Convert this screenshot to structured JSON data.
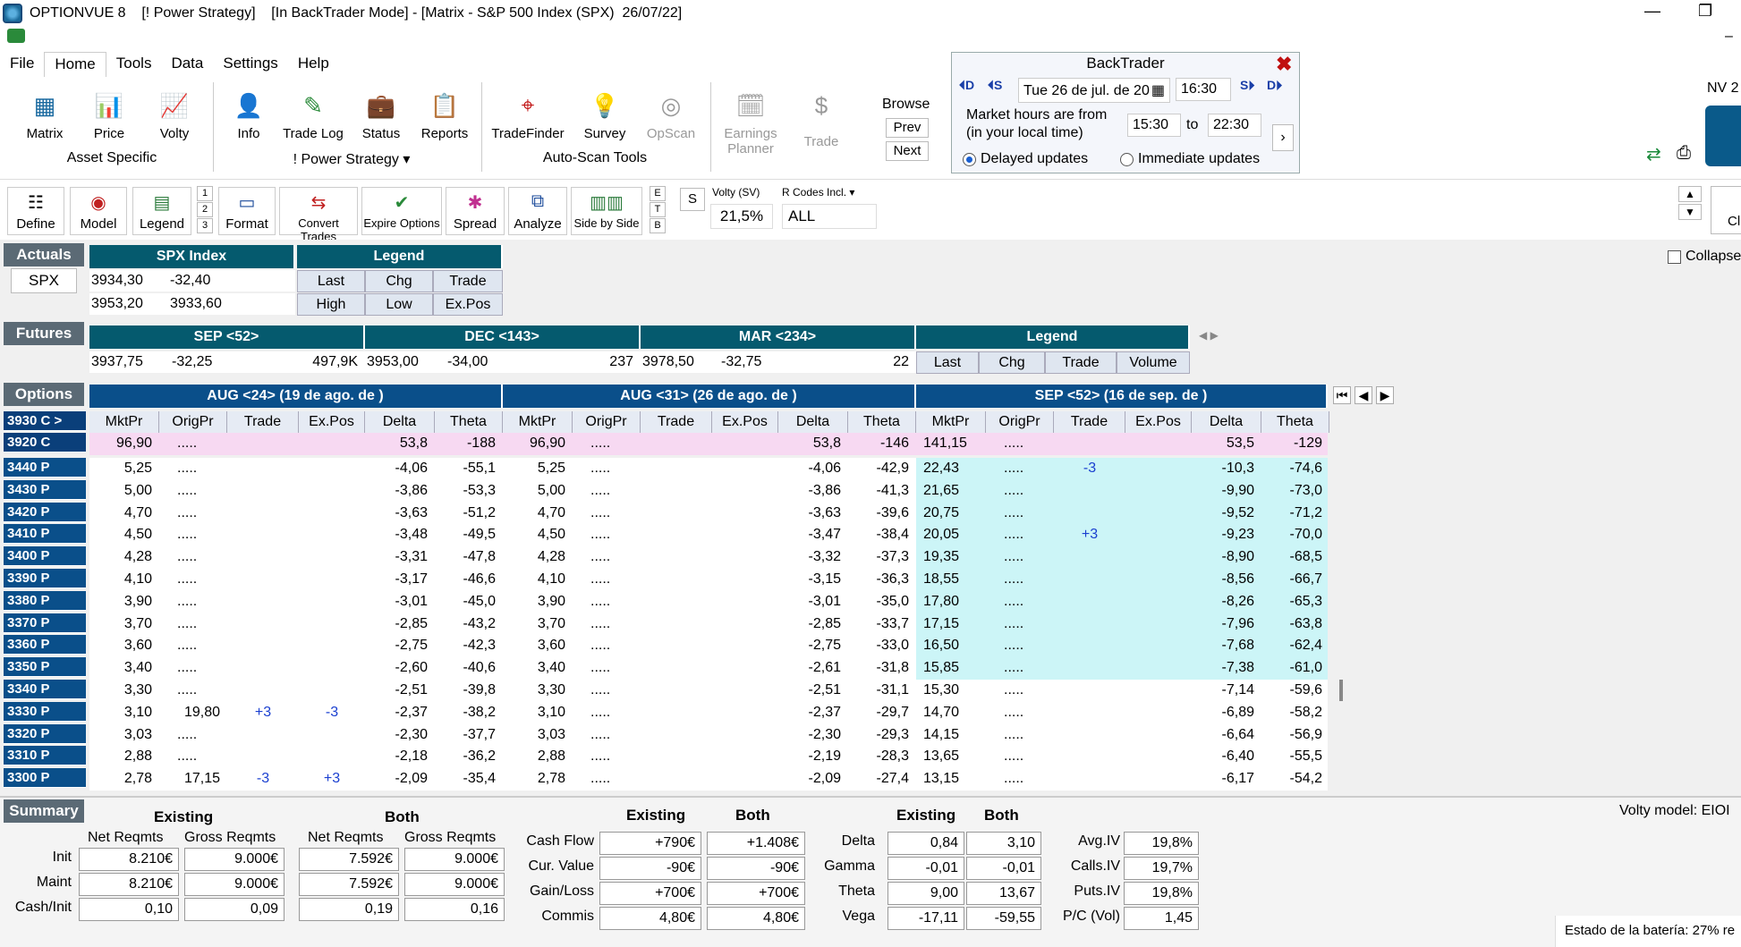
{
  "window": {
    "title": "OPTIONVUE 8    [! Power Strategy]    [In BackTrader Mode] - [Matrix - S&P 500 Index (SPX)  26/07/22]"
  },
  "menu": [
    "File",
    "Home",
    "Tools",
    "Data",
    "Settings",
    "Help"
  ],
  "ribbon": {
    "buttons": {
      "matrix": "Matrix",
      "price": "Price",
      "volty": "Volty",
      "info": "Info",
      "tradelog": "Trade Log",
      "status": "Status",
      "reports": "Reports",
      "tradefinder": "TradeFinder",
      "survey": "Survey",
      "opscan": "OpScan",
      "earnings": "Earnings\nPlanner",
      "trade": "Trade"
    },
    "groups": {
      "asset": "Asset Specific",
      "strategy": "! Power Strategy",
      "autoscan": "Auto-Scan Tools"
    },
    "browse": {
      "label": "Browse",
      "prev": "Prev",
      "next": "Next"
    }
  },
  "backtrader": {
    "title": "BackTrader",
    "date": "Tue 26 de jul. de 20",
    "time": "16:30",
    "hours_text": "Market hours are from (in your local time)",
    "from": "15:30",
    "to_label": "to",
    "to": "22:30",
    "delayed": "Delayed updates",
    "immediate": "Immediate updates",
    "nav": {
      "d1": "D",
      "s1": "S",
      "s2": "S",
      "d2": "D"
    }
  },
  "nv_label": "NV 2",
  "toolbar": {
    "define": "Define",
    "model": "Model",
    "legend": "Legend",
    "format": "Format",
    "convert": "Convert Trades",
    "expire": "Expire Options",
    "spread": "Spread",
    "analyze": "Analyze",
    "sidebyside": "Side by Side",
    "nums": [
      "1",
      "2",
      "3"
    ],
    "etb": [
      "E",
      "T",
      "B"
    ],
    "s": "S",
    "volty_label": "Volty (SV)",
    "volty_value": "21,5%",
    "rcodes_label": "R Codes Incl.",
    "rcodes_value": "ALL",
    "cl": "Cl"
  },
  "actuals": {
    "label": "Actuals",
    "symbol": "SPX",
    "header": "SPX Index",
    "last": "3934,30",
    "chg": "-32,40",
    "high": "3953,20",
    "low": "3933,60",
    "legend": {
      "title": "Legend",
      "last": "Last",
      "chg": "Chg",
      "trade": "Trade",
      "high": "High",
      "low": "Low",
      "expos": "Ex.Pos"
    }
  },
  "collapse": "Collapse",
  "futures": {
    "label": "Futures",
    "items": [
      {
        "header": "SEP <52>",
        "last": "3937,75",
        "chg": "-32,25",
        "vol": "497,9K"
      },
      {
        "header": "DEC <143>",
        "last": "3953,00",
        "chg": "-34,00",
        "vol": "237"
      },
      {
        "header": "MAR <234>",
        "last": "3978,50",
        "chg": "-32,75",
        "vol": "22"
      }
    ],
    "legend": {
      "title": "Legend",
      "cols": [
        "Last",
        "Chg",
        "Trade",
        "Volume"
      ]
    }
  },
  "options": {
    "label": "Options",
    "expirations": [
      "AUG <24> (19 de ago. de )",
      "AUG <31> (26 de ago. de )",
      "SEP <52> (16 de sep. de )"
    ],
    "columns": [
      "MktPr",
      "OrigPr",
      "Trade",
      "Ex.Pos",
      "Delta",
      "Theta"
    ],
    "rows": [
      {
        "label": "3930 C >",
        "type": "call",
        "cells": [
          [
            "",
            "",
            "",
            "",
            "",
            ""
          ],
          [
            "",
            "",
            "",
            "",
            "",
            ""
          ],
          [
            "",
            "",
            "",
            "",
            "",
            ""
          ]
        ]
      },
      {
        "label": "3920 C",
        "type": "call",
        "cells": [
          [
            "96,90",
            ".....",
            "",
            "",
            "53,8",
            "-188"
          ],
          [
            "96,90",
            ".....",
            "",
            "",
            "53,8",
            "-146"
          ],
          [
            "141,15",
            ".....",
            "",
            "",
            "53,5",
            "-129"
          ]
        ]
      },
      {
        "label": "3440 P",
        "type": "put",
        "cells": [
          [
            "5,25",
            ".....",
            "",
            "",
            "-4,06",
            "-55,1"
          ],
          [
            "5,25",
            ".....",
            "",
            "",
            "-4,06",
            "-42,9"
          ],
          [
            "22,43",
            ".....",
            "-3",
            "",
            "-10,3",
            "-74,6"
          ]
        ]
      },
      {
        "label": "3430 P",
        "type": "put",
        "cells": [
          [
            "5,00",
            ".....",
            "",
            "",
            "-3,86",
            "-53,3"
          ],
          [
            "5,00",
            ".....",
            "",
            "",
            "-3,86",
            "-41,3"
          ],
          [
            "21,65",
            ".....",
            "",
            "",
            "-9,90",
            "-73,0"
          ]
        ]
      },
      {
        "label": "3420 P",
        "type": "put",
        "cells": [
          [
            "4,70",
            ".....",
            "",
            "",
            "-3,63",
            "-51,2"
          ],
          [
            "4,70",
            ".....",
            "",
            "",
            "-3,63",
            "-39,6"
          ],
          [
            "20,75",
            ".....",
            "",
            "",
            "-9,52",
            "-71,2"
          ]
        ]
      },
      {
        "label": "3410 P",
        "type": "put",
        "cells": [
          [
            "4,50",
            ".....",
            "",
            "",
            "-3,48",
            "-49,5"
          ],
          [
            "4,50",
            ".....",
            "",
            "",
            "-3,47",
            "-38,4"
          ],
          [
            "20,05",
            ".....",
            "+3",
            "",
            "-9,23",
            "-70,0"
          ]
        ]
      },
      {
        "label": "3400 P",
        "type": "put",
        "cells": [
          [
            "4,28",
            ".....",
            "",
            "",
            "-3,31",
            "-47,8"
          ],
          [
            "4,28",
            ".....",
            "",
            "",
            "-3,32",
            "-37,3"
          ],
          [
            "19,35",
            ".....",
            "",
            "",
            "-8,90",
            "-68,5"
          ]
        ]
      },
      {
        "label": "3390 P",
        "type": "put",
        "cells": [
          [
            "4,10",
            ".....",
            "",
            "",
            "-3,17",
            "-46,6"
          ],
          [
            "4,10",
            ".....",
            "",
            "",
            "-3,15",
            "-36,3"
          ],
          [
            "18,55",
            ".....",
            "",
            "",
            "-8,56",
            "-66,7"
          ]
        ]
      },
      {
        "label": "3380 P",
        "type": "put",
        "cells": [
          [
            "3,90",
            ".....",
            "",
            "",
            "-3,01",
            "-45,0"
          ],
          [
            "3,90",
            ".....",
            "",
            "",
            "-3,01",
            "-35,0"
          ],
          [
            "17,80",
            ".....",
            "",
            "",
            "-8,26",
            "-65,3"
          ]
        ]
      },
      {
        "label": "3370 P",
        "type": "put",
        "cells": [
          [
            "3,70",
            ".....",
            "",
            "",
            "-2,85",
            "-43,2"
          ],
          [
            "3,70",
            ".....",
            "",
            "",
            "-2,85",
            "-33,7"
          ],
          [
            "17,15",
            ".....",
            "",
            "",
            "-7,96",
            "-63,8"
          ]
        ]
      },
      {
        "label": "3360 P",
        "type": "put",
        "cells": [
          [
            "3,60",
            ".....",
            "",
            "",
            "-2,75",
            "-42,3"
          ],
          [
            "3,60",
            ".....",
            "",
            "",
            "-2,75",
            "-33,0"
          ],
          [
            "16,50",
            ".....",
            "",
            "",
            "-7,68",
            "-62,4"
          ]
        ]
      },
      {
        "label": "3350 P",
        "type": "put",
        "cells": [
          [
            "3,40",
            ".....",
            "",
            "",
            "-2,60",
            "-40,6"
          ],
          [
            "3,40",
            ".....",
            "",
            "",
            "-2,61",
            "-31,8"
          ],
          [
            "15,85",
            ".....",
            "",
            "",
            "-7,38",
            "-61,0"
          ]
        ]
      },
      {
        "label": "3340 P",
        "type": "put",
        "cells": [
          [
            "3,30",
            ".....",
            "",
            "",
            "-2,51",
            "-39,8"
          ],
          [
            "3,30",
            ".....",
            "",
            "",
            "-2,51",
            "-31,1"
          ],
          [
            "15,30",
            ".....",
            "",
            "",
            "-7,14",
            "-59,6"
          ]
        ]
      },
      {
        "label": "3330 P",
        "type": "put",
        "cells": [
          [
            "3,10",
            "19,80",
            "+3",
            "-3",
            "-2,37",
            "-38,2"
          ],
          [
            "3,10",
            ".....",
            "",
            "",
            "-2,37",
            "-29,7"
          ],
          [
            "14,70",
            ".....",
            "",
            "",
            "-6,89",
            "-58,2"
          ]
        ]
      },
      {
        "label": "3320 P",
        "type": "put",
        "cells": [
          [
            "3,03",
            ".....",
            "",
            "",
            "-2,30",
            "-37,7"
          ],
          [
            "3,03",
            ".....",
            "",
            "",
            "-2,30",
            "-29,3"
          ],
          [
            "14,15",
            ".....",
            "",
            "",
            "-6,64",
            "-56,9"
          ]
        ]
      },
      {
        "label": "3310 P",
        "type": "put",
        "cells": [
          [
            "2,88",
            ".....",
            "",
            "",
            "-2,18",
            "-36,2"
          ],
          [
            "2,88",
            ".....",
            "",
            "",
            "-2,19",
            "-28,3"
          ],
          [
            "13,65",
            ".....",
            "",
            "",
            "-6,40",
            "-55,5"
          ]
        ]
      },
      {
        "label": "3300 P",
        "type": "put",
        "cells": [
          [
            "2,78",
            "17,15",
            "-3",
            "+3",
            "-2,09",
            "-35,4"
          ],
          [
            "2,78",
            ".....",
            "",
            "",
            "-2,09",
            "-27,4"
          ],
          [
            "13,15",
            ".....",
            "",
            "",
            "-6,17",
            "-54,2"
          ]
        ]
      }
    ],
    "highlights": {
      "pink": "#f7d9f2",
      "cyan": "#ccf5f7"
    }
  },
  "summary": {
    "label": "Summary",
    "existing": "Existing",
    "both": "Both",
    "net": "Net Reqmts",
    "gross": "Gross Reqmts",
    "row_labels": [
      "Init",
      "Maint",
      "Cash/Init"
    ],
    "existing_net": [
      "8.210€",
      "8.210€",
      "0,10"
    ],
    "existing_gross": [
      "9.000€",
      "9.000€",
      "0,09"
    ],
    "both_net": [
      "7.592€",
      "7.592€",
      "0,19"
    ],
    "both_gross": [
      "9.000€",
      "9.000€",
      "0,16"
    ],
    "cash_labels": [
      "Cash Flow",
      "Cur. Value",
      "Gain/Loss",
      "Commis"
    ],
    "cash_existing": [
      "+790€",
      "-90€",
      "+700€",
      "4,80€"
    ],
    "cash_both": [
      "+1.408€",
      "-90€",
      "+700€",
      "4,80€"
    ],
    "greek_labels": [
      "Delta",
      "Gamma",
      "Theta",
      "Vega"
    ],
    "greek_existing": [
      "0,84",
      "-0,01",
      "9,00",
      "-17,11"
    ],
    "greek_both": [
      "3,10",
      "-0,01",
      "13,67",
      "-59,55"
    ],
    "iv_labels": [
      "Avg.IV",
      "Calls.IV",
      "Puts.IV",
      "P/C (Vol)"
    ],
    "iv_values": [
      "19,8%",
      "19,7%",
      "19,8%",
      "1,45"
    ],
    "volty_model": "Volty model: EIOI",
    "battery": "Estado de la batería: 27% re"
  }
}
